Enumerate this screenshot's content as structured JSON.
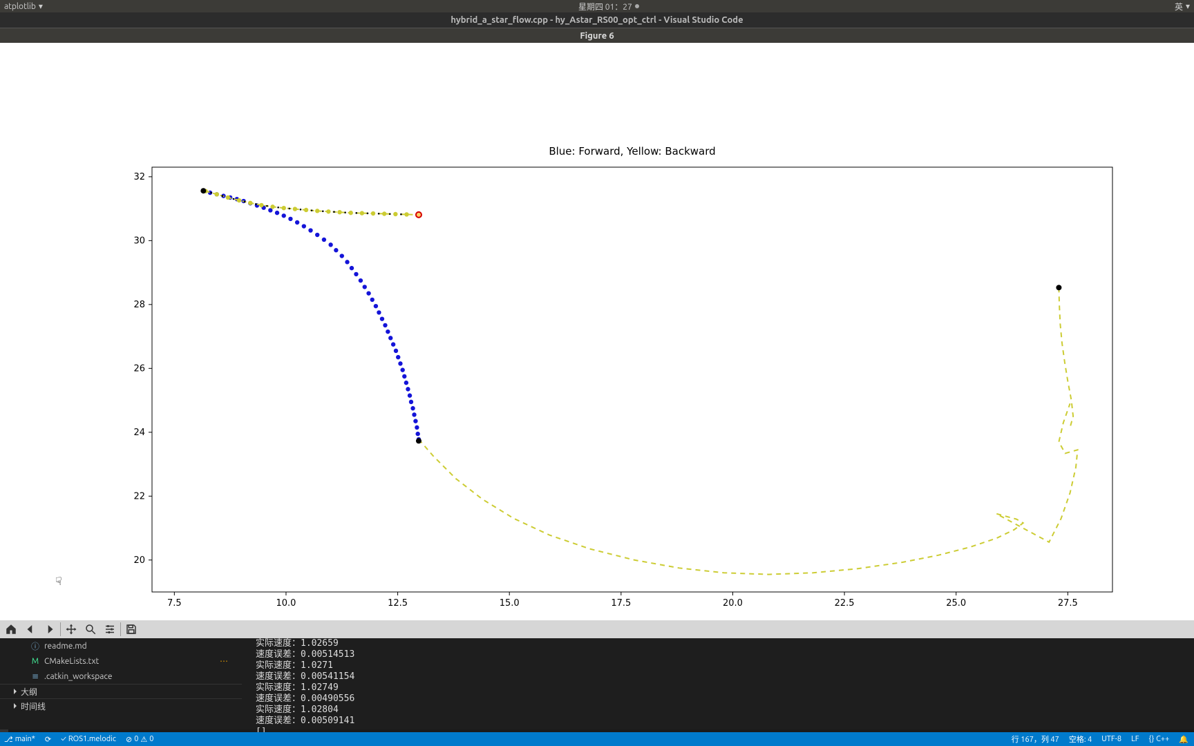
{
  "system": {
    "app_menu": "atplotlib",
    "clock": "星期四 01：27",
    "ime": "英"
  },
  "vscode_title": "hybrid_a_star_flow.cpp - hy_Astar_RS00_opt_ctrl - Visual Studio Code",
  "figure_title": "Figure 6",
  "chart_data": {
    "type": "line",
    "title": "Blue: Forward, Yellow: Backward",
    "xlim": [
      7.0,
      28.5
    ],
    "ylim": [
      19.0,
      32.3
    ],
    "xticks": [
      7.5,
      10.0,
      12.5,
      15.0,
      17.5,
      20.0,
      22.5,
      25.0,
      27.5
    ],
    "yticks": [
      20,
      22,
      24,
      26,
      28,
      30,
      32
    ],
    "series": [
      {
        "name": "Forward (blue dots)",
        "style": "blue-dots",
        "points": [
          [
            8.15,
            31.55
          ],
          [
            8.3,
            31.5
          ],
          [
            8.45,
            31.45
          ],
          [
            8.6,
            31.4
          ],
          [
            8.75,
            31.35
          ],
          [
            8.9,
            31.3
          ],
          [
            9.05,
            31.24
          ],
          [
            9.2,
            31.17
          ],
          [
            9.35,
            31.1
          ],
          [
            9.5,
            31.03
          ],
          [
            9.65,
            30.95
          ],
          [
            9.8,
            30.87
          ],
          [
            9.95,
            30.78
          ],
          [
            10.1,
            30.68
          ],
          [
            10.25,
            30.57
          ],
          [
            10.4,
            30.45
          ],
          [
            10.55,
            30.32
          ],
          [
            10.7,
            30.18
          ],
          [
            10.85,
            30.03
          ],
          [
            11.0,
            29.87
          ],
          [
            11.12,
            29.7
          ],
          [
            11.25,
            29.52
          ],
          [
            11.37,
            29.33
          ],
          [
            11.47,
            29.14
          ],
          [
            11.57,
            28.95
          ],
          [
            11.67,
            28.75
          ],
          [
            11.76,
            28.55
          ],
          [
            11.85,
            28.35
          ],
          [
            11.93,
            28.15
          ],
          [
            12.01,
            27.95
          ],
          [
            12.08,
            27.75
          ],
          [
            12.15,
            27.55
          ],
          [
            12.22,
            27.35
          ],
          [
            12.28,
            27.15
          ],
          [
            12.34,
            26.95
          ],
          [
            12.4,
            26.75
          ],
          [
            12.46,
            26.55
          ],
          [
            12.51,
            26.35
          ],
          [
            12.56,
            26.15
          ],
          [
            12.61,
            25.95
          ],
          [
            12.65,
            25.75
          ],
          [
            12.69,
            25.55
          ],
          [
            12.73,
            25.35
          ],
          [
            12.77,
            25.15
          ],
          [
            12.8,
            24.95
          ],
          [
            12.84,
            24.75
          ],
          [
            12.87,
            24.55
          ],
          [
            12.9,
            24.35
          ],
          [
            12.93,
            24.15
          ],
          [
            12.95,
            23.95
          ],
          [
            12.97,
            23.78
          ]
        ]
      },
      {
        "name": "Backward top (yellow dots+dashes)",
        "style": "yellow-dots",
        "points": [
          [
            8.2,
            31.55
          ],
          [
            8.45,
            31.45
          ],
          [
            8.7,
            31.35
          ],
          [
            8.95,
            31.26
          ],
          [
            9.2,
            31.18
          ],
          [
            9.45,
            31.11
          ],
          [
            9.7,
            31.06
          ],
          [
            9.95,
            31.02
          ],
          [
            10.2,
            30.99
          ],
          [
            10.45,
            30.96
          ],
          [
            10.7,
            30.93
          ],
          [
            10.95,
            30.91
          ],
          [
            11.2,
            30.89
          ],
          [
            11.45,
            30.87
          ],
          [
            11.7,
            30.86
          ],
          [
            11.95,
            30.85
          ],
          [
            12.2,
            30.84
          ],
          [
            12.45,
            30.83
          ],
          [
            12.7,
            30.82
          ],
          [
            12.95,
            30.81
          ]
        ]
      },
      {
        "name": "Dashed path (yellow dashed long)",
        "style": "yellow-dash",
        "points": [
          [
            12.97,
            23.78
          ],
          [
            13.3,
            23.25
          ],
          [
            13.8,
            22.55
          ],
          [
            14.4,
            21.9
          ],
          [
            15.1,
            21.3
          ],
          [
            15.9,
            20.78
          ],
          [
            16.8,
            20.35
          ],
          [
            17.8,
            20.0
          ],
          [
            18.8,
            19.75
          ],
          [
            19.8,
            19.6
          ],
          [
            20.8,
            19.55
          ],
          [
            21.8,
            19.6
          ],
          [
            22.8,
            19.73
          ],
          [
            23.8,
            19.93
          ],
          [
            24.6,
            20.15
          ],
          [
            25.3,
            20.4
          ],
          [
            25.9,
            20.68
          ],
          [
            26.3,
            20.95
          ],
          [
            26.5,
            21.16
          ],
          [
            26.35,
            21.28
          ],
          [
            25.9,
            21.45
          ],
          [
            27.08,
            20.56
          ],
          [
            27.35,
            21.3
          ],
          [
            27.55,
            22.1
          ],
          [
            27.68,
            22.9
          ],
          [
            27.72,
            23.45
          ],
          [
            27.44,
            23.34
          ],
          [
            27.3,
            23.7
          ],
          [
            27.4,
            24.3
          ],
          [
            27.55,
            24.9
          ],
          [
            27.3,
            28.53
          ],
          [
            27.31,
            28.0
          ],
          [
            27.33,
            27.4
          ],
          [
            27.37,
            26.8
          ],
          [
            27.43,
            26.2
          ],
          [
            27.5,
            25.6
          ],
          [
            27.58,
            25.0
          ],
          [
            27.62,
            24.5
          ],
          [
            27.55,
            24.15
          ]
        ]
      },
      {
        "name": "Marker: end blue black",
        "style": "black-dot",
        "points": [
          [
            12.97,
            23.73
          ]
        ]
      },
      {
        "name": "Marker: right black",
        "style": "black-dot",
        "points": [
          [
            27.3,
            28.53
          ]
        ]
      },
      {
        "name": "Marker: start black",
        "style": "black-dot",
        "points": [
          [
            8.15,
            31.56
          ]
        ]
      },
      {
        "name": "Marker: red end",
        "style": "red-circle",
        "points": [
          [
            12.97,
            30.81
          ]
        ]
      }
    ]
  },
  "sidebar": {
    "files": [
      {
        "icon": "info",
        "name": "readme.md"
      },
      {
        "icon": "M",
        "name": "CMakeLists.txt",
        "status": "modified"
      },
      {
        "icon": "cfg",
        "name": ".catkin_workspace"
      }
    ],
    "outline_label": "大纲",
    "timeline_label": "时间线"
  },
  "terminal": {
    "lines": [
      "实际速度：1.02659",
      "速度误差：0.00514513",
      "实际速度：1.0271",
      "速度误差：0.00541154",
      "实际速度：1.02749",
      "速度误差：0.00490556",
      "实际速度：1.02804",
      "速度误差：0.00509141",
      "[]"
    ]
  },
  "statusbar": {
    "branch": "main*",
    "ros": "ROS1.melodic",
    "errors": "0",
    "warnings": "0",
    "position": "行 167，列 47",
    "spaces": "空格: 4",
    "encoding": "UTF-8",
    "eol": "LF",
    "lang": "C++",
    "bell": "🔔"
  }
}
